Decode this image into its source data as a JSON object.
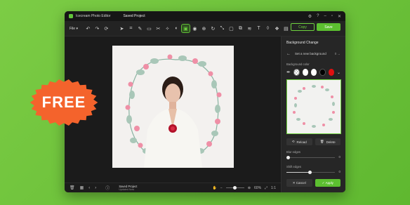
{
  "app": {
    "name": "Icecream Photo Editor",
    "document": "Saved Project"
  },
  "toolbar": {
    "file_label": "File",
    "copy_label": "Copy",
    "save_label": "Save"
  },
  "panel": {
    "title": "Background Change",
    "set_new_bg_label": "Set a new background",
    "set_new_bg_value": "0 →",
    "bg_color_label": "Background color",
    "swatch_colors": [
      "#1a1a1a",
      "#ffffff",
      "#ffffff",
      "#000000",
      "#e01010"
    ],
    "reload_label": "Reload",
    "delete_label": "Delete",
    "blur_label": "Blur edges",
    "blur_value": "0",
    "shift_label": "Shift edges",
    "shift_value": "0",
    "cancel_label": "Cancel",
    "apply_label": "Apply"
  },
  "status": {
    "project_title": "Saved Project",
    "project_sub": "Updated Now",
    "zoom": "60%",
    "fit_label": "1:1"
  },
  "badge": {
    "text": "FREE",
    "color": "#f4632c"
  }
}
